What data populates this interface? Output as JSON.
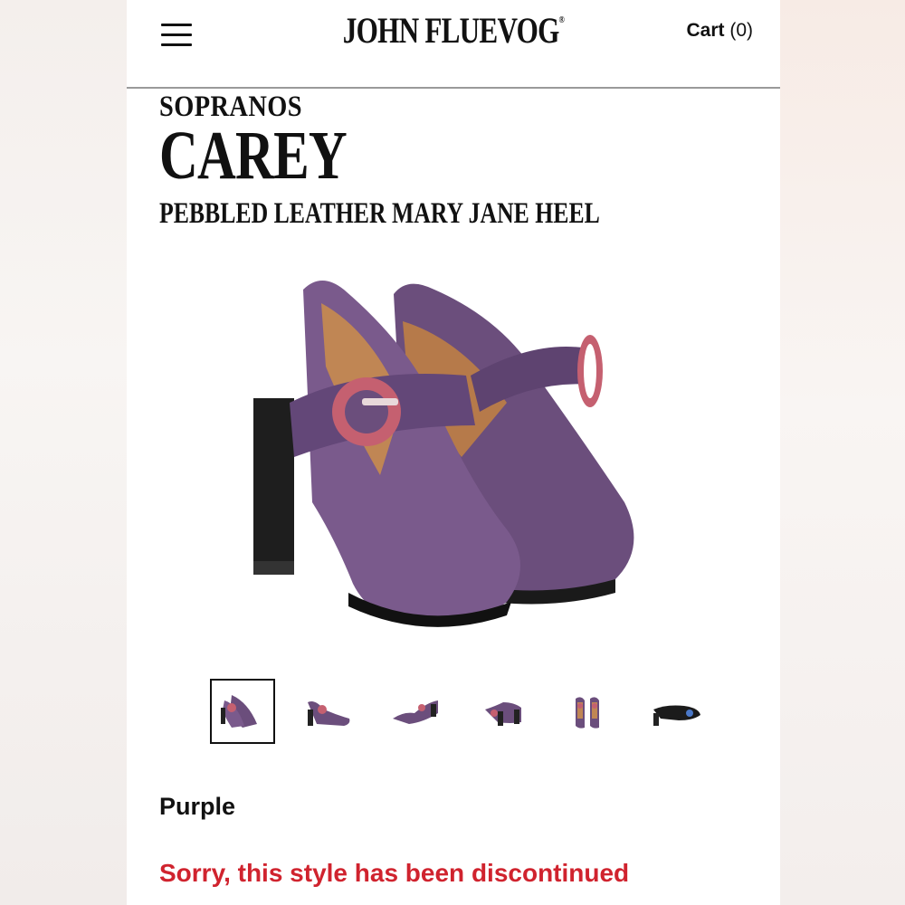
{
  "header": {
    "menu_icon": "hamburger-menu-icon",
    "logo_text": "John Fluevog",
    "cart_label": "Cart",
    "cart_count": "(0)"
  },
  "product": {
    "collection": "SOPRANOS",
    "name": "CAREY",
    "subtitle": "PEBBLED LEATHER MARY JANE HEEL",
    "color": "Purple",
    "status_message": "Sorry, this style has been discontinued"
  },
  "gallery": {
    "thumbnail_count": 6,
    "active_index": 0
  },
  "colors": {
    "shoe_purple": "#6b4e7c",
    "buckle_pink": "#c56070",
    "alert_red": "#d0232e"
  }
}
